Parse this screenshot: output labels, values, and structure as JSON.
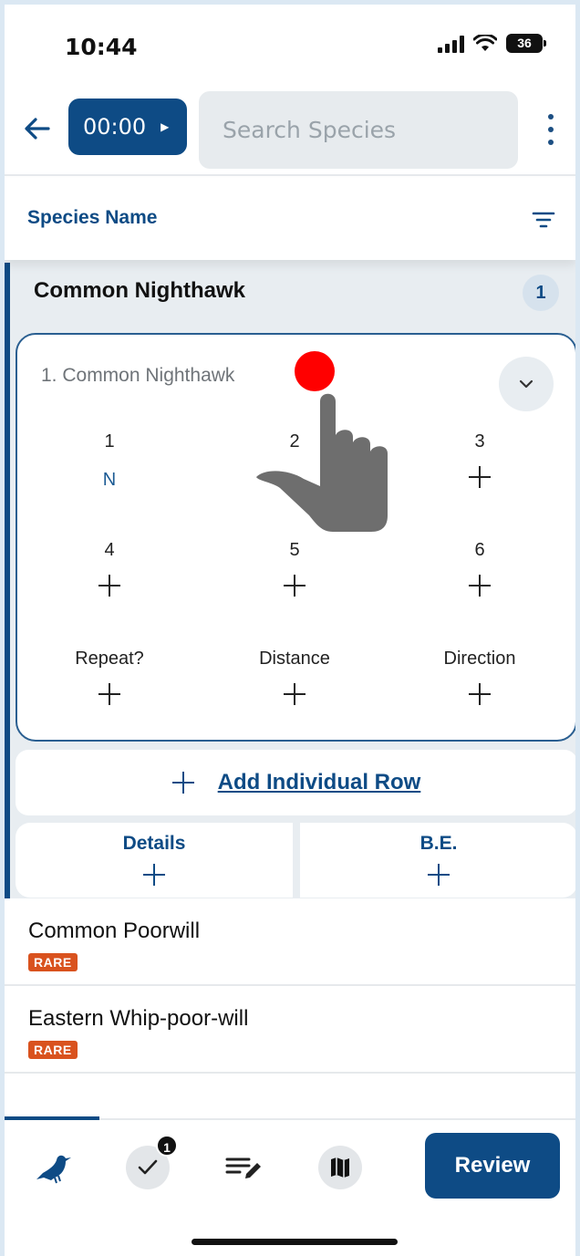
{
  "status_bar": {
    "time": "10:44",
    "battery": "36"
  },
  "toolbar": {
    "timer": "00:00",
    "search_placeholder": "Search Species"
  },
  "sort": {
    "label": "Species Name"
  },
  "expanded_species": {
    "name": "Common Nighthawk",
    "count": "1",
    "individual": {
      "title": "1. Common Nighthawk",
      "cells": [
        {
          "label": "1",
          "value": "N"
        },
        {
          "label": "2",
          "value": ""
        },
        {
          "label": "3",
          "value": ""
        },
        {
          "label": "4",
          "value": ""
        },
        {
          "label": "5",
          "value": ""
        },
        {
          "label": "6",
          "value": ""
        },
        {
          "label": "Repeat?",
          "value": ""
        },
        {
          "label": "Distance",
          "value": ""
        },
        {
          "label": "Direction",
          "value": ""
        }
      ]
    },
    "add_row_label": "Add Individual Row",
    "details_label": "Details",
    "be_label": "B.E."
  },
  "species_list": [
    {
      "name": "Common Poorwill",
      "badge": "RARE"
    },
    {
      "name": "Eastern Whip-poor-will",
      "badge": "RARE"
    }
  ],
  "tabbar": {
    "tabs": [
      "bird-icon",
      "checklist-icon",
      "notes-icon",
      "map-icon"
    ],
    "checklist_badge": "1",
    "review_label": "Review"
  },
  "colors": {
    "primary": "#0e4b85",
    "rare": "#d9521e",
    "touch": "#ff0000"
  }
}
